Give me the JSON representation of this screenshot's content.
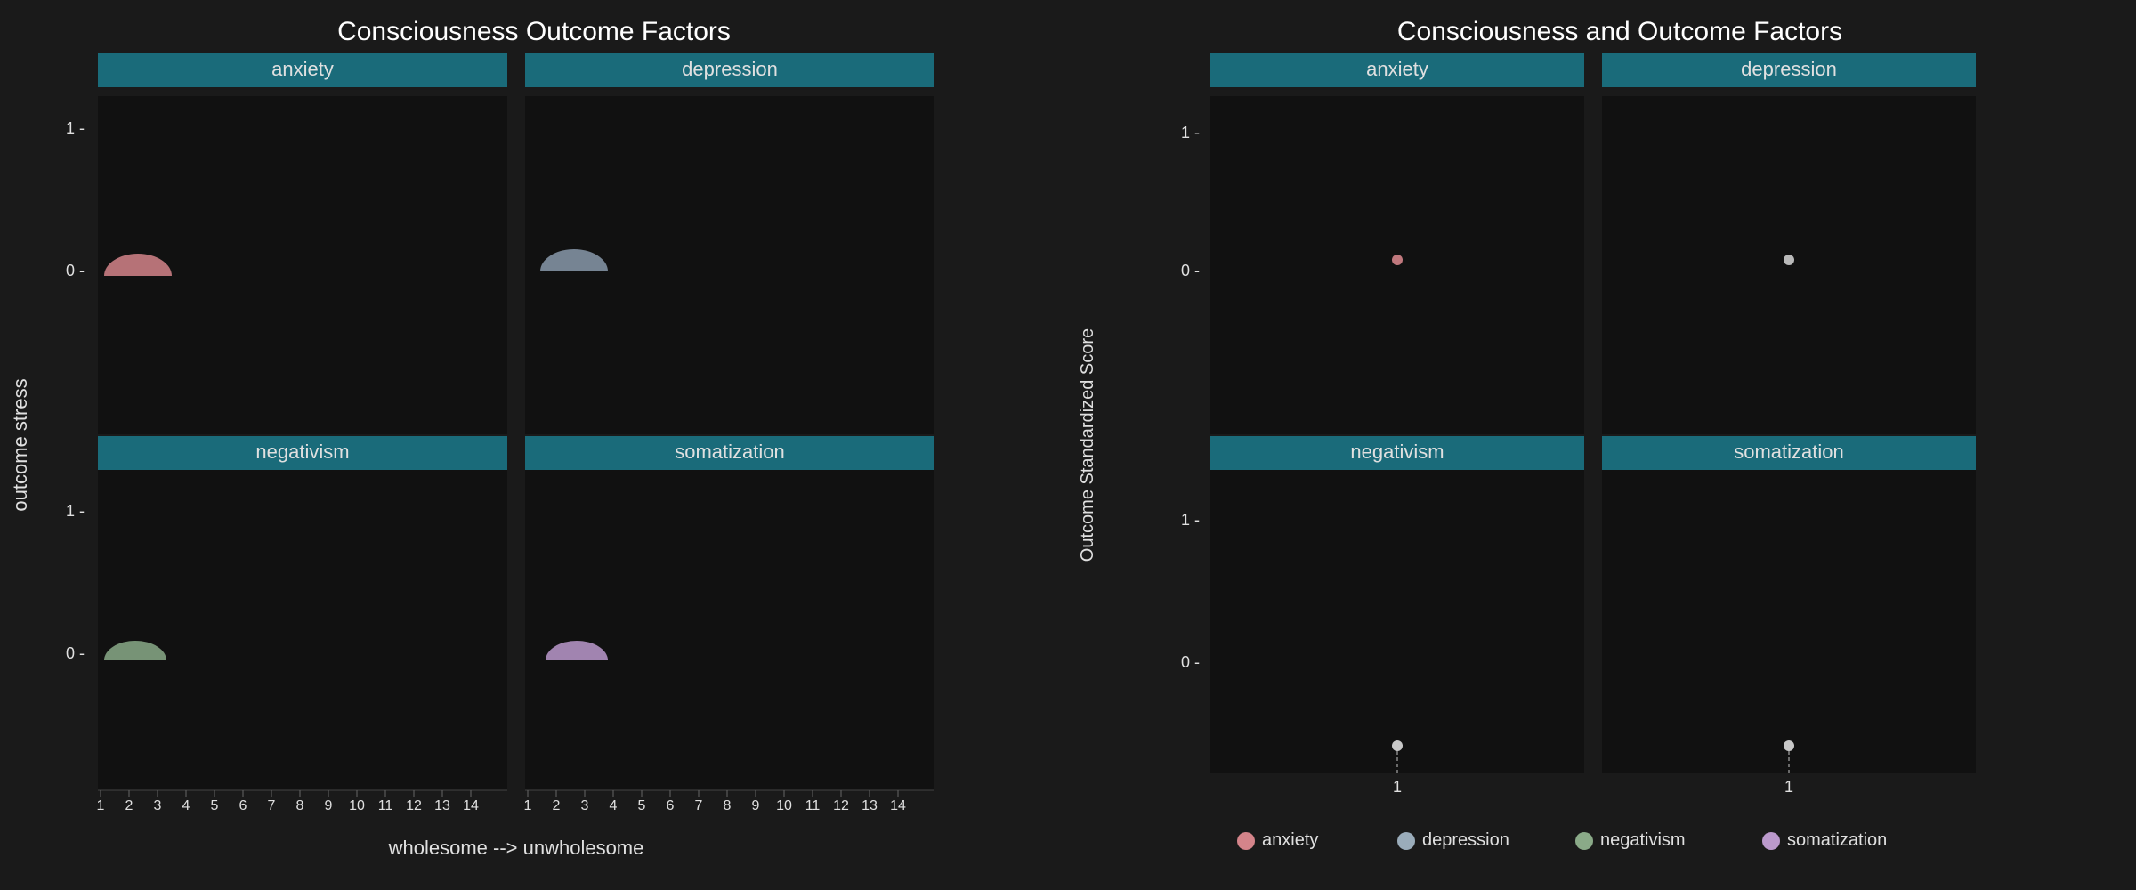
{
  "left_chart": {
    "title": "Consciousness Outcome Factors",
    "facet_top_labels": [
      "anxiety",
      "depression"
    ],
    "facet_bottom_labels": [
      "negativism",
      "somatization"
    ],
    "y_axis_label": "outcome stress",
    "x_axis_label": "wholesome --> unwholesome",
    "x_ticks": [
      "1",
      "2",
      "3",
      "4",
      "5",
      "6",
      "7",
      "8",
      "9",
      "10",
      "11",
      "12",
      "13",
      "14"
    ],
    "y_ticks_top": [
      "1",
      "0"
    ],
    "y_ticks_bottom": [
      "1",
      "0"
    ],
    "colors": {
      "anxiety": "#d4848a",
      "depression": "#8899aa",
      "negativism": "#8aaa88",
      "somatization": "#aa99bb"
    }
  },
  "right_chart": {
    "title": "Consciousness and Outcome Factors",
    "facet_top_labels": [
      "anxiety",
      "depression"
    ],
    "facet_bottom_labels": [
      "negativism",
      "somatization"
    ],
    "y_axis_label": "Outcome Standardized Score",
    "x_ticks_bottom": [
      "1",
      "1"
    ],
    "y_ticks_top": [
      "1",
      "0"
    ],
    "y_ticks_bottom": [
      "1",
      "0"
    ],
    "colors": {
      "anxiety": "#d4848a",
      "depression": "#8899aa",
      "negativism": "#8aaa88",
      "somatization": "#aa99bb"
    }
  },
  "legend": {
    "items": [
      {
        "label": "anxiety",
        "color": "#d4848a"
      },
      {
        "label": "depression",
        "color": "#9aacba"
      },
      {
        "label": "negativism",
        "color": "#8aaa88"
      },
      {
        "label": "somatization",
        "color": "#bb99cc"
      }
    ]
  }
}
